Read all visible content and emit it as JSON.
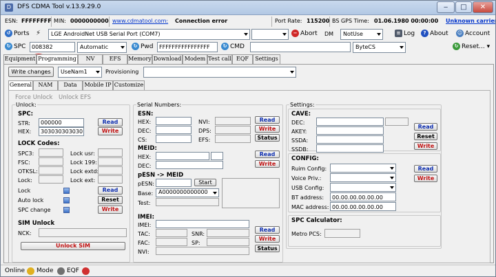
{
  "window": {
    "title": "DFS CDMA Tool v.13.9.29.0",
    "min_glyph": "‒",
    "max_glyph": "□",
    "close_glyph": "✕"
  },
  "status_row": {
    "esn_label": "ESN:",
    "esn_value": "FFFFFFFF",
    "min_label": "MIN:",
    "min_value": "0000000000",
    "site_link": "www.cdmatool.com:",
    "connection": "Connection error",
    "port_rate_label": "Port Rate:",
    "port_rate_value": "115200",
    "bs_gps_label": "BS GPS Time:",
    "bs_gps_value": "01.06.1980 00:00:00",
    "carrier_link": "Unknown carrier"
  },
  "port_row": {
    "ports_label": "Ports",
    "port_value": "LGE AndroidNet USB Serial Port (COM7)",
    "abort_label": "Abort",
    "dm_label": "DM",
    "dm_value": "NotUse",
    "log_label": "Log",
    "about_label": "About",
    "account_label": "Account"
  },
  "spc_row": {
    "spc_label": "SPC",
    "spc_value": "008382",
    "mode_value": "Automatic",
    "pwd_label": "Pwd",
    "pwd_value": "FFFFFFFFFFFFFFFF",
    "cmd_label": "CMD",
    "bytecs_value": "ByteCS",
    "reset_label": "Reset..."
  },
  "main_tabs": [
    "Equipment",
    "Programming",
    "NV",
    "EFS",
    "Memory",
    "Download",
    "Modem",
    "Test call",
    "EQF",
    "Settings"
  ],
  "prog_row": {
    "write_changes": "Write changes",
    "usenam_value": "UseNam1",
    "provisioning_label": "Provisioning"
  },
  "sub_tabs": [
    "General",
    "NAM",
    "Data",
    "Mobile IP",
    "Customize"
  ],
  "actions": {
    "force_unlock": "Force Unlock",
    "unlock_efs": "Unlock EFS"
  },
  "unlock": {
    "title": "Unlock:",
    "spc_title": "SPC:",
    "str_label": "STR:",
    "str_value": "000000",
    "hex_label": "HEX:",
    "hex_value": "303030303030",
    "read": "Read",
    "write": "Write",
    "lock_codes_title": "LOCK Codes:",
    "spc3": "SPC3:",
    "fsc": "FSC:",
    "otksl": "OTKSL:",
    "lock": "Lock:",
    "lock_usr": "Lock usr:",
    "lock_199": "Lock 199:",
    "lock_extd": "Lock extd:",
    "lock_ext": "Lock ext:",
    "lock_chk": "Lock",
    "auto_lock": "Auto lock",
    "spc_change": "SPC change",
    "reset": "Reset",
    "sim_title": "SIM Unlock",
    "nck_label": "NCK:",
    "unlock_sim": "Unlock SIM"
  },
  "serials": {
    "title": "Serial Numbers:",
    "esn_title": "ESN:",
    "hex": "HEX:",
    "dec": "DEC:",
    "cs": "CS:",
    "nvi": "NVI:",
    "dps": "DPS:",
    "efs": "EFS:",
    "read": "Read",
    "write": "Write",
    "status": "Status",
    "meid_title": "MEID:",
    "pesn_title": "pESN -> MEID",
    "pesn_label": "pESN:",
    "start": "Start",
    "base_label": "Base:",
    "base_value": "A0000000000000",
    "test_label": "Test:",
    "imei_title": "IMEI:",
    "imei_label": "IMEI:",
    "tac": "TAC:",
    "fac": "FAC:",
    "nvi2": "NVI:",
    "snr": "SNR:",
    "sp": "SP:"
  },
  "settings": {
    "title": "Settings:",
    "cave_title": "CAVE:",
    "dec": "DEC:",
    "akey": "AKEY:",
    "ssda": "SSDA:",
    "ssdb": "SSDB:",
    "read": "Read",
    "reset": "Reset",
    "write": "Write",
    "config_title": "CONFIG:",
    "ruim": "Ruim Config:",
    "voice": "Voice Priv.:",
    "usb": "USB Config:",
    "bt_label": "BT address:",
    "bt_value": "00.00.00.00.00.00",
    "mac_label": "MAC address:",
    "mac_value": "00.00.00.00.00.00",
    "calc_title": "SPC Calculator:",
    "metro_label": "Metro PCS:"
  },
  "statusbar": {
    "online": "Online",
    "mode": "Mode",
    "eqf": "EQF"
  }
}
